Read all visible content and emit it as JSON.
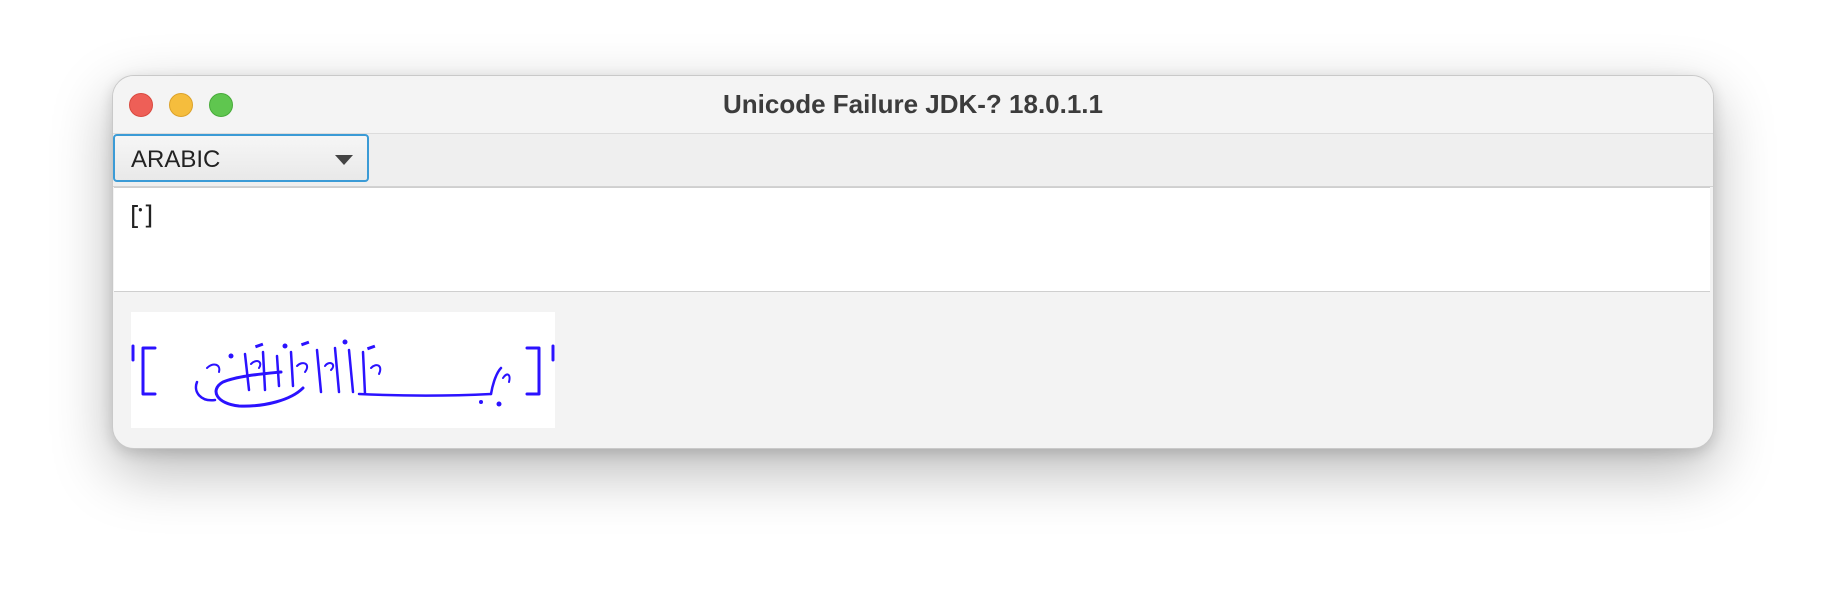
{
  "window": {
    "title": "Unicode Failure JDK-? 18.0.1.1"
  },
  "traffic_lights": {
    "close": "close-icon",
    "minimize": "minimize-icon",
    "zoom": "zoom-icon"
  },
  "script_selector": {
    "selected": "ARABIC",
    "icon": "chevron-down-icon"
  },
  "text_area": {
    "content": "[𑀀]"
  },
  "rendered_image": {
    "bracket_open": "[",
    "bracket_close": "]",
    "ink_color": "#2b12ff"
  },
  "colors": {
    "focus_ring": "#3b9bd6",
    "close": "#ee5f57",
    "minimize": "#f5bd3d",
    "zoom": "#5fc64f"
  }
}
